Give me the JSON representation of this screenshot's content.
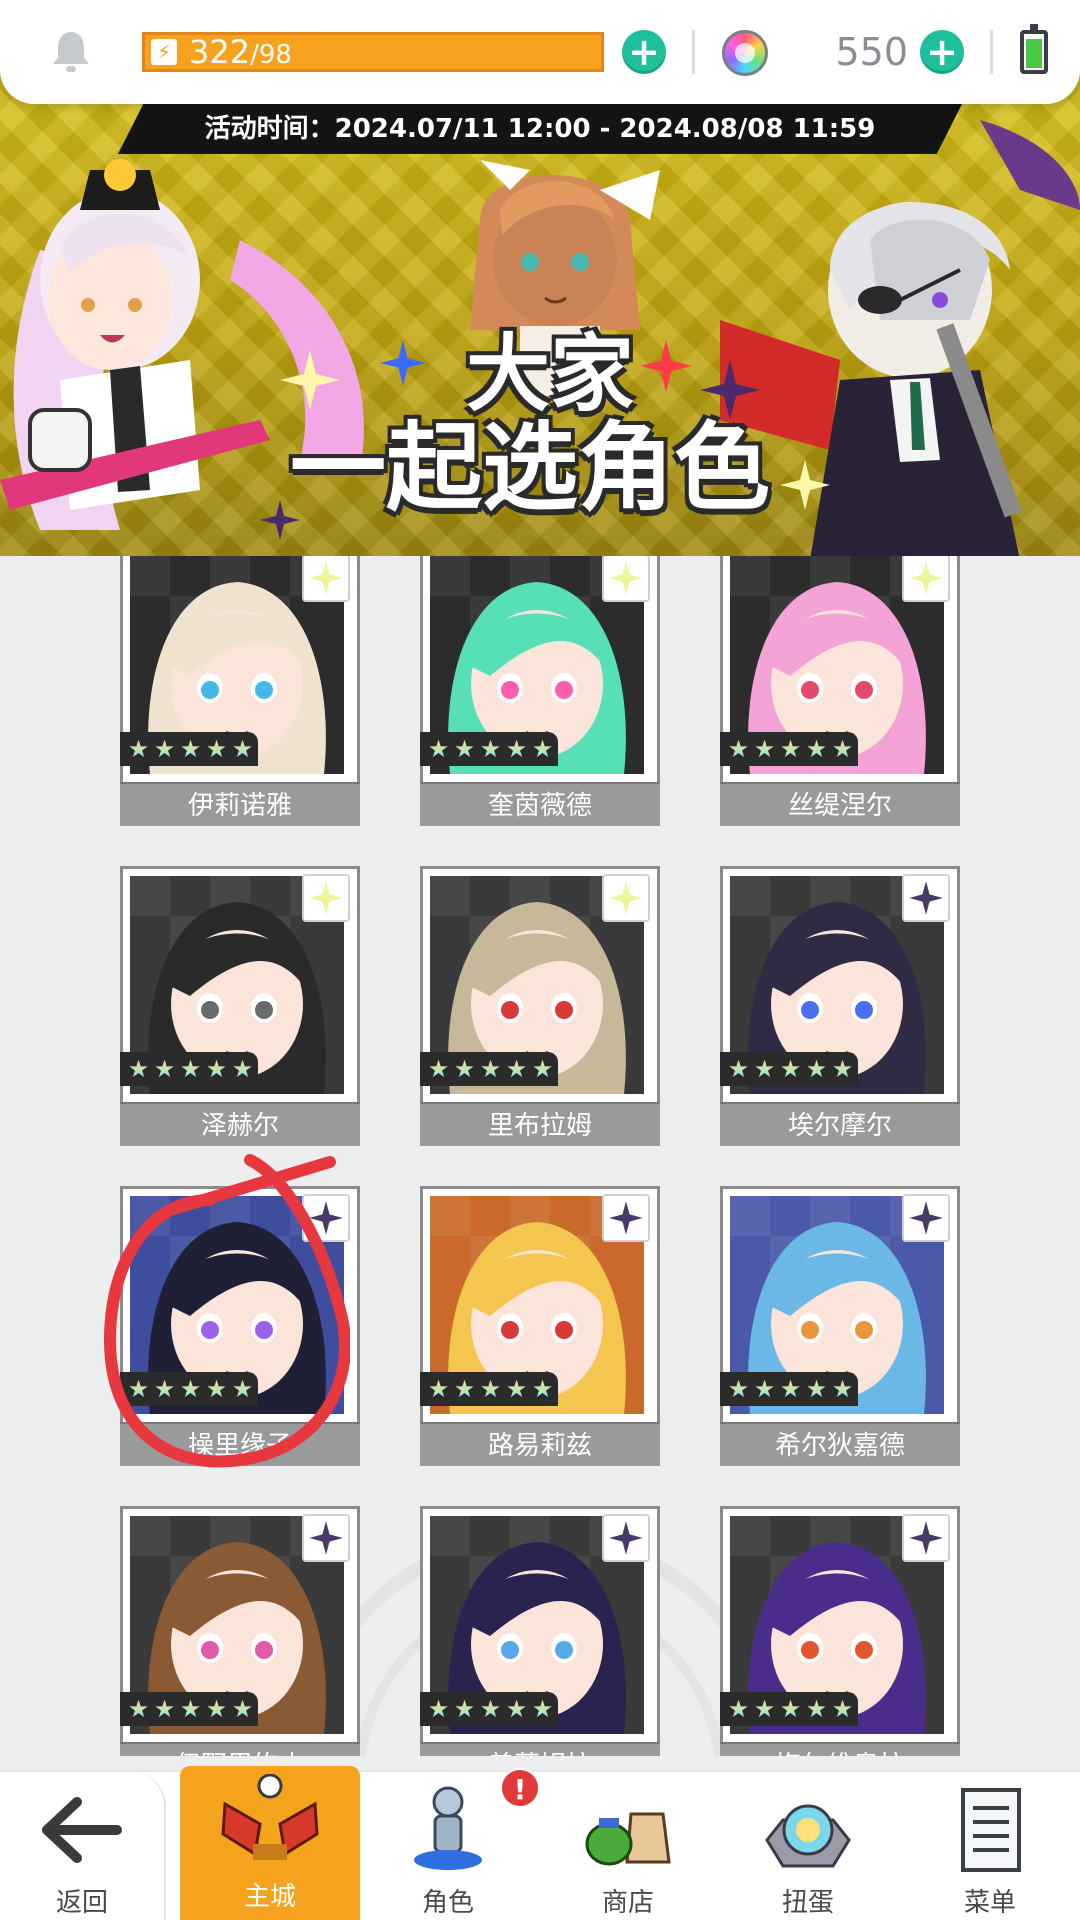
{
  "status_bar": {
    "energy_current": "322",
    "energy_max": "/98",
    "gems": "550",
    "battery_level": 0.8,
    "icons": [
      "bell-icon",
      "bolt-icon",
      "plus-icon",
      "rainbow-gem-icon",
      "battery-icon"
    ]
  },
  "banner": {
    "event_time": "活动时间：2024.07/11 12:00 - 2024.08/08 11:59",
    "title_line1": "大家",
    "title_line2": "一起选角色"
  },
  "characters": [
    {
      "name": "伊莉诺雅",
      "stars": 5,
      "hair": "#efe3cf",
      "bg": "#2c2c2c",
      "eye": "#45b8e8",
      "badge": "light"
    },
    {
      "name": "奎茵薇德",
      "stars": 5,
      "hair": "#57e0b8",
      "bg": "#2c2c2c",
      "eye": "#ff5fa8",
      "badge": "light"
    },
    {
      "name": "丝缇涅尔",
      "stars": 5,
      "hair": "#f4a3d6",
      "bg": "#2c2c2c",
      "eye": "#e24b6a",
      "badge": "light"
    },
    {
      "name": "泽赫尔",
      "stars": 5,
      "hair": "#2a2a2a",
      "bg": "#3a3a3a",
      "eye": "#6a6a6a",
      "badge": "light"
    },
    {
      "name": "里布拉姆",
      "stars": 5,
      "hair": "#c8b89a",
      "bg": "#3a3a3a",
      "eye": "#d83a3a",
      "badge": "light"
    },
    {
      "name": "埃尔摩尔",
      "stars": 5,
      "hair": "#2f2b45",
      "bg": "#3a3a3a",
      "eye": "#4a6ef0",
      "badge": "dark"
    },
    {
      "name": "操里缘子",
      "stars": 5,
      "hair": "#1f2036",
      "bg": "#3f4d9e",
      "eye": "#9a62e8",
      "badge": "dark"
    },
    {
      "name": "路易莉兹",
      "stars": 5,
      "hair": "#f5c64f",
      "bg": "#c96a2c",
      "eye": "#d83a3a",
      "badge": "dark"
    },
    {
      "name": "希尔狄嘉德",
      "stars": 5,
      "hair": "#6bb7e6",
      "bg": "#4a5aa8",
      "eye": "#e8963a",
      "badge": "dark"
    },
    {
      "name": "伊野里绚太",
      "stars": 5,
      "hair": "#8a5a34",
      "bg": "#3a3a3a",
      "eye": "#e25aa8",
      "badge": "dark"
    },
    {
      "name": "普莉姆拉",
      "stars": 5,
      "hair": "#2a2350",
      "bg": "#3a3a3a",
      "eye": "#58a8e8",
      "badge": "dark"
    },
    {
      "name": "梅尔维奥拉",
      "stars": 5,
      "hair": "#4a2c8a",
      "bg": "#3a3a3a",
      "eye": "#e2562e",
      "badge": "dark"
    }
  ],
  "bottom_nav": {
    "back": "返回",
    "home": "主城",
    "character": "角色",
    "shop": "商店",
    "gacha": "扭蛋",
    "menu": "菜单",
    "alert": "!"
  },
  "colors": {
    "accent_orange": "#f5a21c",
    "plus_green": "#1fbf9e",
    "annotation_red": "#e8383f"
  }
}
